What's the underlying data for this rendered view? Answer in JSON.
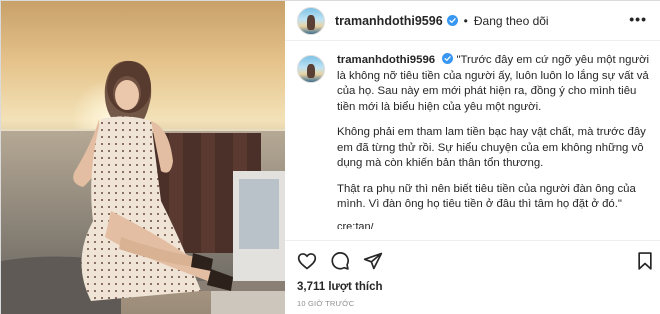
{
  "post": {
    "username": "tramanhdothi9596",
    "follow_status": "Đang theo dõi",
    "more_label": "•••",
    "caption_paragraphs": [
      "\"Trước đây em cứ ngỡ yêu một người là không nỡ tiêu tiền của người ấy, luôn luôn lo lắng sự vất vả của họ. Sau này em mới phát hiện ra, đồng ý cho mình tiêu tiền mới là biểu hiện của yêu một người.",
      "Không phải em tham lam tiền bạc hay vật chất, mà trước đây em đã từng thử rồi. Sự hiểu chuyện của em không những vô dụng mà còn khiến bản thân tổn thương.",
      "Thật ra phụ nữ thì nên biết tiêu tiền của người đàn ông của mình. Vì đàn ông họ tiêu tiền ở đâu thì tâm họ đặt ở đó.\"",
      "cre:fan/"
    ],
    "likes": "3,711 lượt thích",
    "time_ago": "10 GIỜ TRƯỚC"
  },
  "icons": {
    "verified": "verified-badge-icon",
    "like": "heart-icon",
    "comment": "comment-icon",
    "share": "send-icon",
    "save": "bookmark-icon"
  },
  "colors": {
    "verified_blue": "#3897f0",
    "text": "#262626",
    "muted": "#8e8e8e",
    "border": "#dbdbdb"
  }
}
